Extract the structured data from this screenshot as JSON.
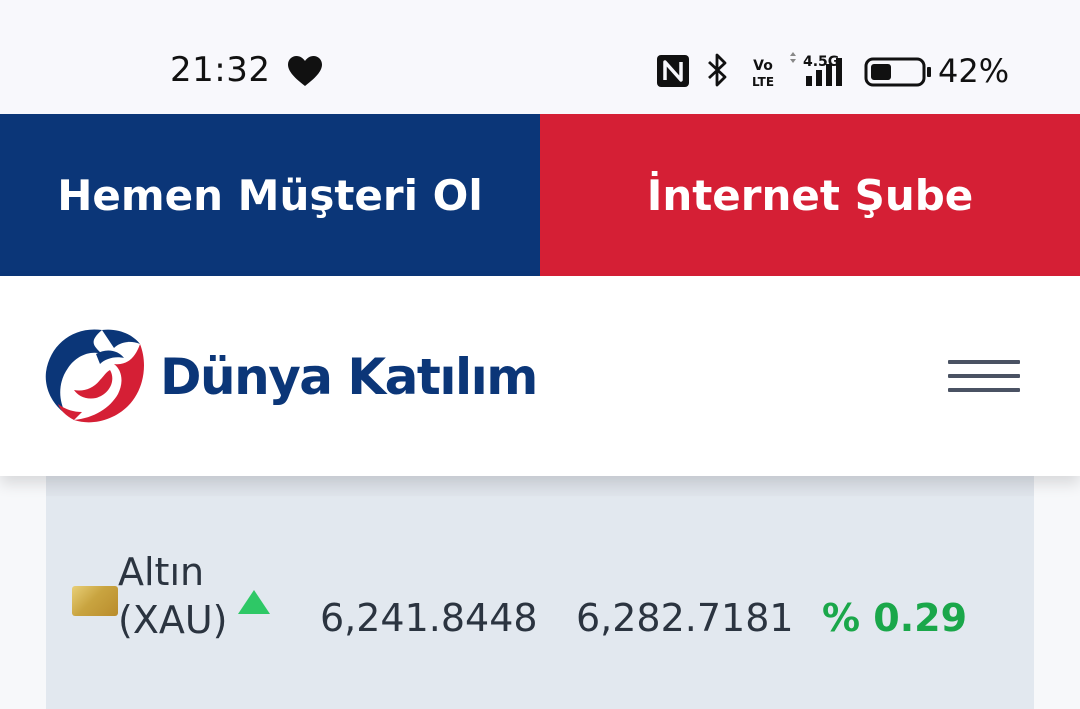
{
  "status_bar": {
    "time": "21:32",
    "battery_percent": "42%",
    "battery_level": 0.42,
    "network_label": "4.5G",
    "volte_label_top": "Vo",
    "volte_label_bottom": "LTE",
    "icons": [
      "heart-icon",
      "nfc-icon",
      "bluetooth-icon",
      "volte-icon",
      "signal-icon",
      "battery-icon"
    ]
  },
  "cta": {
    "customer_label": "Hemen Müşteri Ol",
    "internet_label": "İnternet Şube",
    "colors": {
      "customer_bg": "#0b3678",
      "internet_bg": "#d51f35"
    }
  },
  "header": {
    "logo_text": "Dünya Katılım",
    "brand_colors": {
      "navy": "#0b3678",
      "red": "#d51f35"
    },
    "menu_icon": "hamburger-menu-icon"
  },
  "rates": {
    "rows": [
      {
        "name": "Altın (XAU)",
        "icon": "gold-bar-icon",
        "trend": "up",
        "buy": "6,241.8448",
        "sell": "6,282.7181",
        "change": "% 0.29",
        "change_color": "#1aa74a"
      }
    ]
  }
}
